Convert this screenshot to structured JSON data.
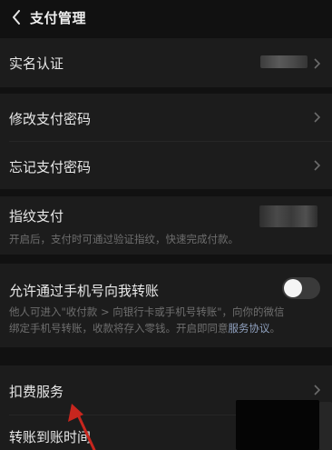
{
  "header": {
    "title": "支付管理"
  },
  "items": {
    "real_name": "实名认证",
    "change_password": "修改支付密码",
    "forgot_password": "忘记支付密码",
    "fingerprint": "指纹支付",
    "fingerprint_desc": "开启后，支付时可通过验证指纹，快速完成付款。",
    "allow_phone": "允许通过手机号向我转账",
    "allow_phone_desc_1": "他人可进入\"收付款 > 向银行卡或手机号转账\"，向你的微信",
    "allow_phone_desc_2": "绑定手机号转账，收款将存入零钱。开启即同意",
    "allow_phone_link": "服务协议",
    "allow_phone_desc_end": "。",
    "deduction": "扣费服务",
    "transfer_time": "转账到账时间"
  },
  "states": {
    "allow_phone_toggle": "off"
  },
  "icons": [
    "back-arrow-icon",
    "chevron-right-icon"
  ],
  "colors": {
    "background": "#111111",
    "card": "#1c1c1c",
    "link": "#8fa0be",
    "annotation": "#c8261e"
  }
}
